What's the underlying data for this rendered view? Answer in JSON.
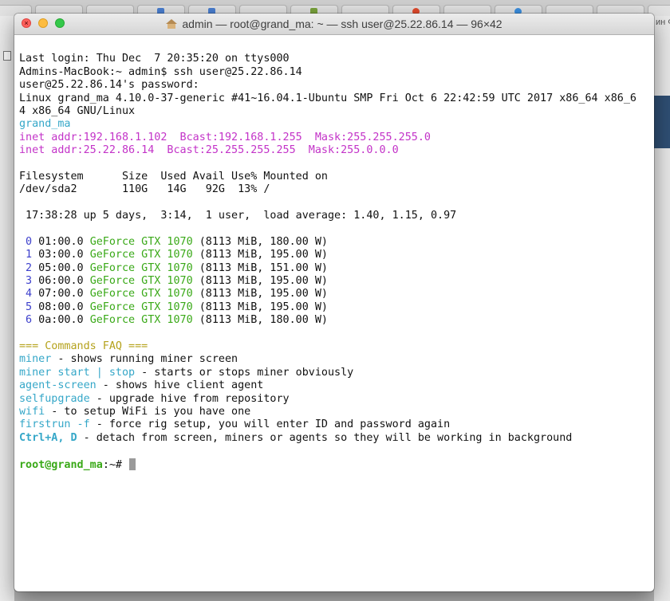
{
  "window": {
    "title": "admin — root@grand_ma: ~ — ssh user@25.22.86.14 — 96×42",
    "icon": "home-icon",
    "close_glyph": "×"
  },
  "background": {
    "right_edge_text": "ин Ф"
  },
  "terminal": {
    "last_login": "Last login: Thu Dec  7 20:35:20 on ttys000",
    "ssh_command": "Admins-MacBook:~ admin$ ssh user@25.22.86.14",
    "password_prompt": "user@25.22.86.14's password:",
    "uname_1": "Linux grand_ma 4.10.0-37-generic #41~16.04.1-Ubuntu SMP Fri Oct 6 22:42:59 UTC 2017 x86_64 x86_6",
    "uname_2": "4 x86_64 GNU/Linux",
    "hostname": "grand_ma",
    "inet_1": "inet addr:192.168.1.102  Bcast:192.168.1.255  Mask:255.255.255.0",
    "inet_2": "inet addr:25.22.86.14  Bcast:25.255.255.255  Mask:255.0.0.0",
    "df_header": "Filesystem      Size  Used Avail Use% Mounted on",
    "df_row": "/dev/sda2       110G   14G   92G  13% /",
    "uptime": " 17:38:28 up 5 days,  3:14,  1 user,  load average: 1.40, 1.15, 0.97",
    "gpus": [
      {
        "index": " 0",
        "bus": " 01:00.0 ",
        "model": "GeForce GTX 1070",
        "spec": " (8113 MiB, 180.00 W)"
      },
      {
        "index": " 1",
        "bus": " 03:00.0 ",
        "model": "GeForce GTX 1070",
        "spec": " (8113 MiB, 195.00 W)"
      },
      {
        "index": " 2",
        "bus": " 05:00.0 ",
        "model": "GeForce GTX 1070",
        "spec": " (8113 MiB, 151.00 W)"
      },
      {
        "index": " 3",
        "bus": " 06:00.0 ",
        "model": "GeForce GTX 1070",
        "spec": " (8113 MiB, 195.00 W)"
      },
      {
        "index": " 4",
        "bus": " 07:00.0 ",
        "model": "GeForce GTX 1070",
        "spec": " (8113 MiB, 195.00 W)"
      },
      {
        "index": " 5",
        "bus": " 08:00.0 ",
        "model": "GeForce GTX 1070",
        "spec": " (8113 MiB, 195.00 W)"
      },
      {
        "index": " 6",
        "bus": " 0a:00.0 ",
        "model": "GeForce GTX 1070",
        "spec": " (8113 MiB, 180.00 W)"
      }
    ],
    "faq_title": "=== Commands FAQ ===",
    "faq": [
      {
        "cmd": "miner",
        "desc": " - shows running miner screen"
      },
      {
        "cmd": "miner start | stop",
        "desc": " - starts or stops miner obviously"
      },
      {
        "cmd": "agent-screen",
        "desc": " - shows hive client agent"
      },
      {
        "cmd": "selfupgrade",
        "desc": " - upgrade hive from repository"
      },
      {
        "cmd": "wifi",
        "desc": " - to setup WiFi is you have one"
      },
      {
        "cmd": "firstrun -f",
        "desc": " - force rig setup, you will enter ID and password again"
      }
    ],
    "faq_hotkey": {
      "cmd": "Ctrl+A, D",
      "desc": " - detach from screen, miners or agents so they will be working in background"
    },
    "prompt_user": "root@grand_ma",
    "prompt_path": ":~# "
  },
  "colors": {
    "cyan": "#35a7c8",
    "magenta": "#c333c8",
    "green": "#3aa918",
    "blue": "#3c3fcc",
    "yellow": "#b5a21c"
  }
}
